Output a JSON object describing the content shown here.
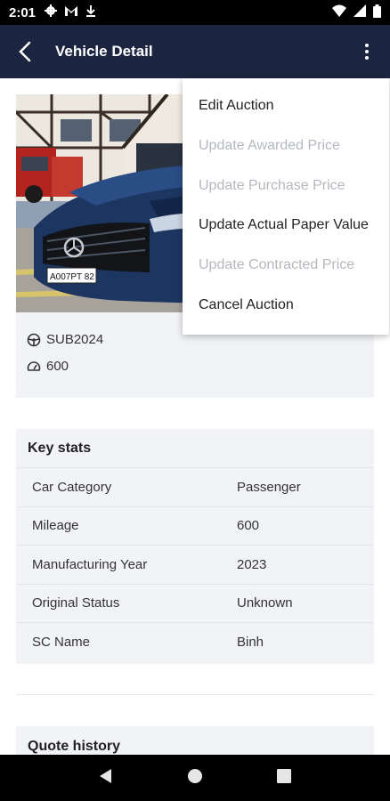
{
  "status_bar": {
    "time": "2:01"
  },
  "app_bar": {
    "title": "Vehicle Detail"
  },
  "vehicle": {
    "plate": "SUB2024",
    "mileage": "600",
    "photo_plate": "A007PT 82"
  },
  "key_stats": {
    "title": "Key stats",
    "rows": [
      {
        "label": "Car Category",
        "value": "Passenger"
      },
      {
        "label": "Mileage",
        "value": "600"
      },
      {
        "label": "Manufacturing Year",
        "value": "2023"
      },
      {
        "label": "Original Status",
        "value": "Unknown"
      },
      {
        "label": "SC Name",
        "value": "Binh"
      }
    ]
  },
  "quote_history": {
    "title": "Quote history"
  },
  "menu": {
    "items": [
      {
        "label": "Edit Auction",
        "enabled": true
      },
      {
        "label": "Update Awarded Price",
        "enabled": false
      },
      {
        "label": "Update Purchase Price",
        "enabled": false
      },
      {
        "label": "Update Actual Paper Value",
        "enabled": true
      },
      {
        "label": "Update Contracted Price",
        "enabled": false
      },
      {
        "label": "Cancel Auction",
        "enabled": true
      }
    ]
  },
  "colors": {
    "app_bar": "#1c2540",
    "card_bg": "#f1f3f6",
    "disabled_text": "#b4b8be"
  }
}
